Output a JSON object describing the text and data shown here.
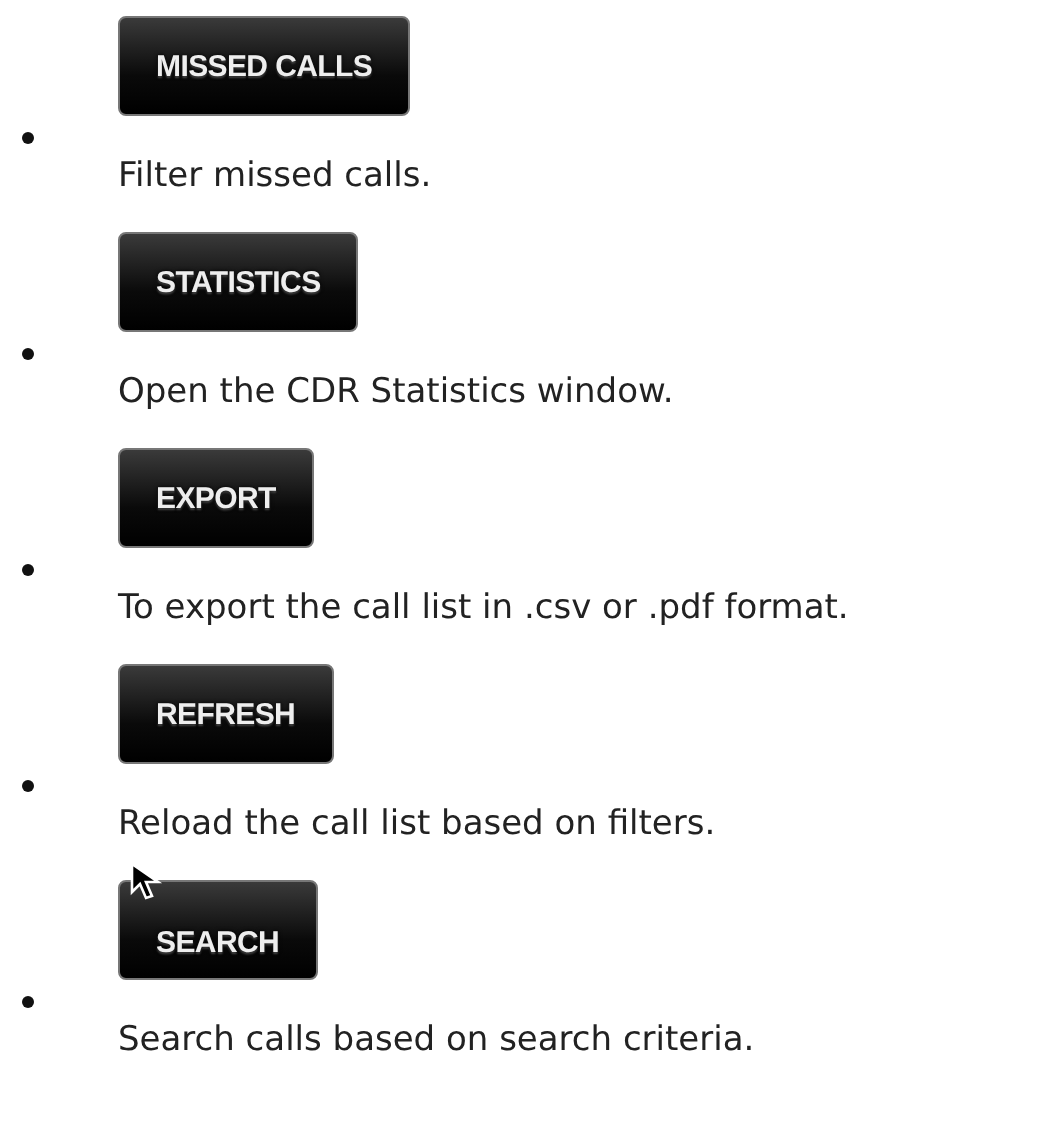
{
  "items": [
    {
      "button": "MISSED CALLS",
      "description": "Filter missed calls.",
      "cursor": false
    },
    {
      "button": "STATISTICS",
      "description": "Open the CDR Statistics window.",
      "cursor": false
    },
    {
      "button": "EXPORT",
      "description": "To export the call list in .csv or .pdf format.",
      "cursor": false
    },
    {
      "button": "REFRESH",
      "description": "Reload the call list based on filters.",
      "cursor": false
    },
    {
      "button": "SEARCH",
      "description": "Search calls based on search criteria.",
      "cursor": true
    }
  ]
}
